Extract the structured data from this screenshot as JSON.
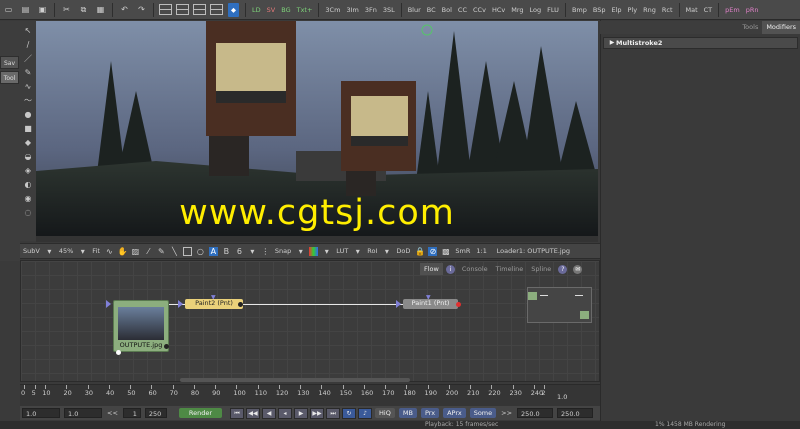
{
  "toolbar": {
    "layout_buttons": [
      "LD"
    ],
    "buttons": [
      {
        "label": "LD",
        "style": "green"
      },
      {
        "label": "SV",
        "style": "red"
      },
      {
        "label": "BG",
        "style": "green"
      },
      {
        "label": "Txt+",
        "style": "green"
      },
      {
        "label": "3Cm",
        "style": ""
      },
      {
        "label": "3Im",
        "style": ""
      },
      {
        "label": "3Fn",
        "style": ""
      },
      {
        "label": "3SL",
        "style": ""
      },
      {
        "label": "Blur",
        "style": ""
      },
      {
        "label": "BC",
        "style": ""
      },
      {
        "label": "Bol",
        "style": ""
      },
      {
        "label": "CC",
        "style": ""
      },
      {
        "label": "CCv",
        "style": ""
      },
      {
        "label": "HCv",
        "style": ""
      },
      {
        "label": "Mrg",
        "style": ""
      },
      {
        "label": "Log",
        "style": ""
      },
      {
        "label": "FLU",
        "style": ""
      },
      {
        "label": "Bmp",
        "style": ""
      },
      {
        "label": "BSp",
        "style": ""
      },
      {
        "label": "Elp",
        "style": ""
      },
      {
        "label": "Ply",
        "style": ""
      },
      {
        "label": "Rng",
        "style": ""
      },
      {
        "label": "Rct",
        "style": ""
      },
      {
        "label": "Mat",
        "style": ""
      },
      {
        "label": "CT",
        "style": ""
      },
      {
        "label": "pEm",
        "style": "pink"
      },
      {
        "label": "pRn",
        "style": "pink"
      }
    ]
  },
  "left_tabs": [
    "Sav",
    "Tool"
  ],
  "viewer": {
    "watermark": "www.cgtsj.com"
  },
  "viewer_bar": {
    "subv": "SubV",
    "zoom": "45%",
    "fit": "Fit",
    "snap": "Snap",
    "lut": "LUT",
    "roi": "RoI",
    "dod": "DoD",
    "smr": "SmR",
    "one_to_one": "1:1",
    "status": "Loader1: OUTPUTE.jpg"
  },
  "flow": {
    "tabs": [
      {
        "label": "Flow",
        "active": true
      },
      {
        "label": "Console",
        "active": false
      },
      {
        "label": "Timeline",
        "active": false
      },
      {
        "label": "Spline",
        "active": false
      }
    ],
    "nodes": {
      "paint2": "Paint2 (Pnt)",
      "paint1": "Paint1 (Pnt)",
      "loader": "OUTPUTE.jpg"
    }
  },
  "timeline": {
    "ticks": [
      "0",
      "5",
      "10",
      "20",
      "30",
      "40",
      "50",
      "60",
      "70",
      "80",
      "90",
      "100",
      "110",
      "120",
      "130",
      "140",
      "150",
      "160",
      "170",
      "180",
      "190",
      "200",
      "210",
      "220",
      "230",
      "240",
      "2"
    ],
    "end_value": "1.0"
  },
  "transport": {
    "start": "1.0",
    "render_start": "1.0",
    "prev_label": "<<",
    "current": "1",
    "range_end": "250",
    "render_label": "Render",
    "hiq": "HiQ",
    "mb": "MB",
    "prx": "Prx",
    "aprx": "APrx",
    "some": "Some",
    "next_label": ">>",
    "render_end": "250.0",
    "global_end": "250.0"
  },
  "right_panel": {
    "tabs": [
      {
        "label": "Tools",
        "active": false
      },
      {
        "label": "Modifiers",
        "active": true
      }
    ],
    "header": "Multistroke2"
  },
  "status_bar": {
    "left": "Playback: 15 frames/sec",
    "right": "1% 1458 MB  Rendering"
  },
  "colors": {
    "node_paint": "#ead17a",
    "node_loader": "#8cae7e",
    "render_button": "#4e8a45",
    "watermark": "#ffee00",
    "active_blue": "#2f6fbf"
  }
}
